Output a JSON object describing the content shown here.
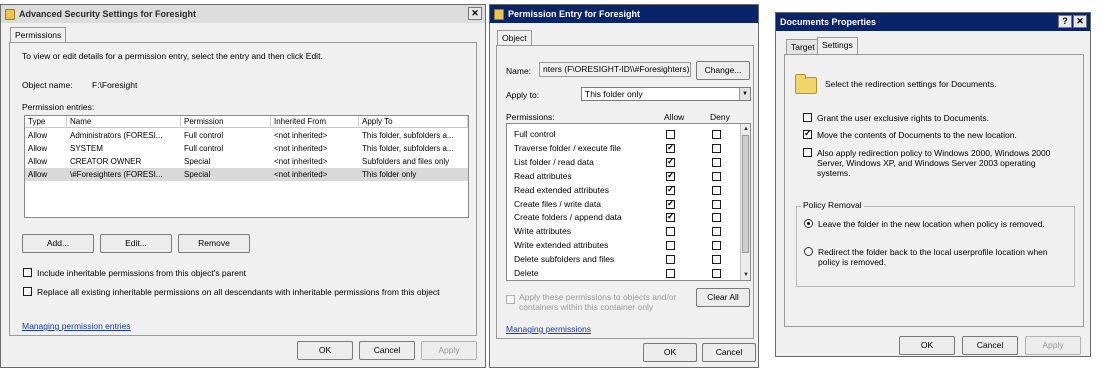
{
  "dialog1": {
    "title": "Advanced Security Settings for Foresight",
    "tab": "Permissions",
    "intro": "To view or edit details for a permission entry, select the entry and then click Edit.",
    "object_name_label": "Object name:",
    "object_name_value": "F:\\Foresight",
    "entries_label": "Permission entries:",
    "columns": [
      "Type",
      "Name",
      "Permission",
      "Inherited From",
      "Apply To"
    ],
    "rows": [
      [
        "Allow",
        "Administrators (FORESI...",
        "Full control",
        "<not inherited>",
        "This folder, subfolders a..."
      ],
      [
        "Allow",
        "SYSTEM",
        "Full control",
        "<not inherited>",
        "This folder, subfolders a..."
      ],
      [
        "Allow",
        "CREATOR OWNER",
        "Special",
        "<not inherited>",
        "Subfolders and files only"
      ],
      [
        "Allow",
        "\\#Foresighters (FORESI...",
        "Special",
        "<not inherited>",
        "This folder only"
      ]
    ],
    "add_label": "Add...",
    "edit_label": "Edit...",
    "remove_label": "Remove",
    "include_inheritable": "Include inheritable permissions from this object's parent",
    "replace_all": "Replace all existing inheritable permissions on all descendants with inheritable permissions from this object",
    "link": "Managing permission entries",
    "ok": "OK",
    "cancel": "Cancel",
    "apply": "Apply",
    "close_glyph": "✕"
  },
  "dialog2": {
    "title": "Permission Entry for Foresight",
    "tab": "Object",
    "name_label": "Name:",
    "name_value": "nters (F\\ORESIGHT-ID\\\\#Foresighters)",
    "change_label": "Change...",
    "apply_to_label": "Apply to:",
    "apply_to_value": "This folder only",
    "permissions_label": "Permissions:",
    "allow_header": "Allow",
    "deny_header": "Deny",
    "permissions": [
      {
        "name": "Full control",
        "allow": false,
        "deny": false
      },
      {
        "name": "Traverse folder / execute file",
        "allow": true,
        "deny": false
      },
      {
        "name": "List folder / read data",
        "allow": true,
        "deny": false
      },
      {
        "name": "Read attributes",
        "allow": true,
        "deny": false
      },
      {
        "name": "Read extended attributes",
        "allow": true,
        "deny": false
      },
      {
        "name": "Create files / write data",
        "allow": true,
        "deny": false
      },
      {
        "name": "Create folders / append data",
        "allow": true,
        "deny": false
      },
      {
        "name": "Write attributes",
        "allow": false,
        "deny": false
      },
      {
        "name": "Write extended attributes",
        "allow": false,
        "deny": false
      },
      {
        "name": "Delete subfolders and files",
        "allow": false,
        "deny": false
      },
      {
        "name": "Delete",
        "allow": false,
        "deny": false
      }
    ],
    "apply_children_line1": "Apply these permissions to objects and/or",
    "apply_children_line2": "containers within this container only",
    "clear_all": "Clear All",
    "link": "Managing permissions",
    "ok": "OK",
    "cancel": "Cancel"
  },
  "dialog3": {
    "title": "Documents Properties",
    "help_glyph": "?",
    "close_glyph": "✕",
    "tabs": [
      "Target",
      "Settings"
    ],
    "intro": "Select the redirection settings for Documents.",
    "grant_exclusive": "Grant the user exclusive rights to Documents.",
    "move_contents": "Move the contents of Documents to the new location.",
    "also_apply_1": "Also apply redirection policy to Windows 2000, Windows 2000",
    "also_apply_2": "Server, Windows XP, and Windows Server 2003 operating",
    "also_apply_3": "systems.",
    "policy_removal": "Policy Removal",
    "leave_folder": "Leave the folder in the new location when policy is removed.",
    "redirect_back_1": "Redirect the folder back to the local userprofile location when",
    "redirect_back_2": "policy is removed.",
    "ok": "OK",
    "cancel": "Cancel",
    "apply": "Apply"
  }
}
